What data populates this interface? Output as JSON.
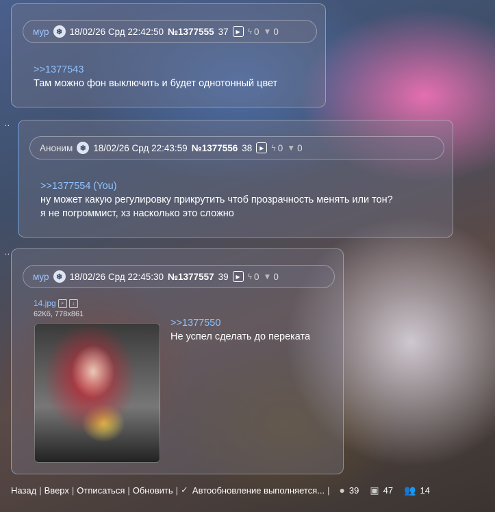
{
  "posts": [
    {
      "name": "мур",
      "date": "18/02/26 Срд 22:42:50",
      "number": "№1377555",
      "index": "37",
      "likes": "0",
      "dislikes": "0",
      "reply_link": ">>1377543",
      "lines": [
        "Там можно фон выключить и будет однотонный цвет"
      ]
    },
    {
      "name": "Аноним",
      "date": "18/02/26 Срд 22:43:59",
      "number": "№1377556",
      "index": "38",
      "likes": "0",
      "dislikes": "0",
      "reply_link": ">>1377554 (You)",
      "lines": [
        "ну может какую регулировку прикрутить чтоб прозрачность менять или тон?",
        "я не погроммист, хз насколько это сложно"
      ]
    },
    {
      "name": "мур",
      "date": "18/02/26 Срд 22:45:30",
      "number": "№1377557",
      "index": "39",
      "likes": "0",
      "dislikes": "0",
      "file_name": "14.jpg",
      "file_meta": "62Кб, 778x861",
      "reply_link": ">>1377550",
      "lines": [
        "Не успел сделать до переката"
      ]
    }
  ],
  "footer": {
    "back": "Назад",
    "top": "Вверх",
    "unsubscribe": "Отписаться",
    "refresh": "Обновить",
    "auto_update": "Автообновление выполняется...",
    "posts_count": "39",
    "images_count": "47",
    "users_count": "14"
  },
  "colors": {
    "accent": "#6ea4e6",
    "link": "#8fc2ff"
  }
}
